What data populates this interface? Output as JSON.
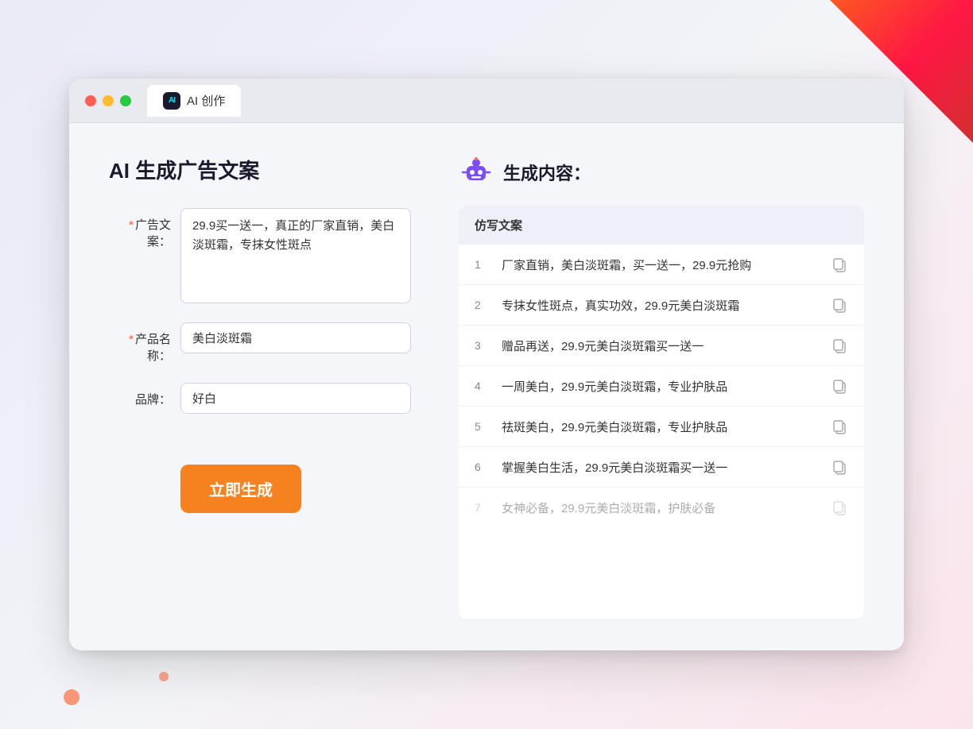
{
  "browser": {
    "tab_title": "AI 创作",
    "tab_icon": "AI"
  },
  "page": {
    "title": "AI 生成广告文案",
    "result_label": "生成内容："
  },
  "form": {
    "ad_copy_label": "广告文案：",
    "ad_copy_required": "*",
    "ad_copy_value": "29.9买一送一，真正的厂家直销，美白淡斑霜，专抹女性斑点",
    "product_label": "产品名称：",
    "product_required": "*",
    "product_value": "美白淡斑霜",
    "brand_label": "品牌：",
    "brand_value": "好白",
    "generate_button": "立即生成"
  },
  "results": {
    "column_header": "仿写文案",
    "items": [
      {
        "id": 1,
        "text": "厂家直销，美白淡斑霜，买一送一，29.9元抢购"
      },
      {
        "id": 2,
        "text": "专抹女性斑点，真实功效，29.9元美白淡斑霜"
      },
      {
        "id": 3,
        "text": "赠品再送，29.9元美白淡斑霜买一送一"
      },
      {
        "id": 4,
        "text": "一周美白，29.9元美白淡斑霜，专业护肤品"
      },
      {
        "id": 5,
        "text": "祛斑美白，29.9元美白淡斑霜，专业护肤品"
      },
      {
        "id": 6,
        "text": "掌握美白生活，29.9元美白淡斑霜买一送一"
      },
      {
        "id": 7,
        "text": "女神必备，29.9元美白淡斑霜，护肤必备",
        "dimmed": true
      }
    ]
  }
}
